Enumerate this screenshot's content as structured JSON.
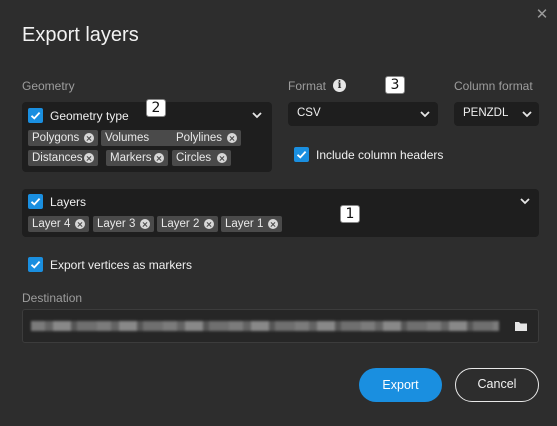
{
  "dialog": {
    "title": "Export layers",
    "close_glyph": "✕"
  },
  "geometry": {
    "label": "Geometry",
    "header_label": "Geometry type",
    "checked": true,
    "chips": [
      "Polygons",
      "Volumes",
      "Polylines",
      "Distances",
      "Markers",
      "Circles"
    ]
  },
  "format": {
    "label": "Format",
    "info_icon": "info-icon",
    "value": "CSV",
    "include_headers_label": "Include column headers",
    "include_headers_checked": true
  },
  "column_format": {
    "label": "Column format",
    "value": "PENZDL"
  },
  "layers": {
    "header_label": "Layers",
    "checked": true,
    "chips": [
      "Layer 4",
      "Layer 3",
      "Layer 2",
      "Layer 1"
    ]
  },
  "export_vertices": {
    "label": "Export vertices as markers",
    "checked": true
  },
  "destination": {
    "label": "Destination"
  },
  "annotations": [
    "1",
    "2",
    "3"
  ],
  "buttons": {
    "export_label": "Export",
    "cancel_label": "Cancel"
  },
  "colors": {
    "accent": "#1a8fe0",
    "background": "#2d2d2d",
    "panel": "#1e1e1e",
    "chip": "#4a4a4a"
  }
}
